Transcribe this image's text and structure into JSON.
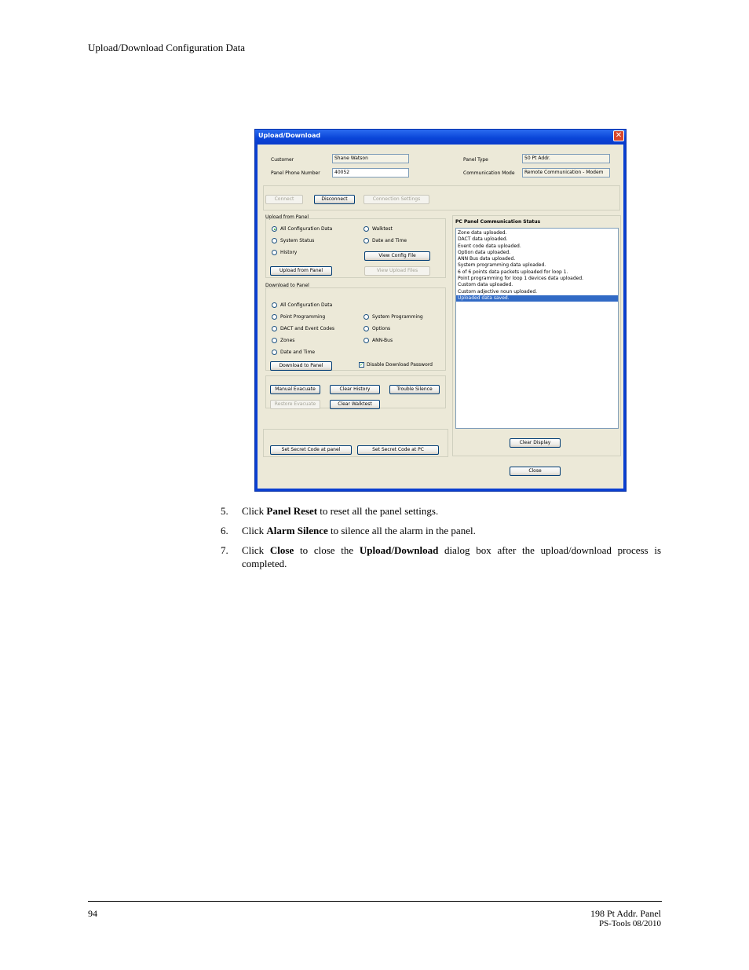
{
  "header": {
    "section_title": "Upload/Download Configuration Data"
  },
  "dialog": {
    "title": "Upload/Download",
    "close_glyph": "✕",
    "customer_label": "Customer",
    "customer_value": "Shane Watson",
    "phone_label": "Panel Phone Number",
    "phone_value": "40052",
    "panel_type_label": "Panel Type",
    "panel_type_value": "50 Pt Addr.",
    "comm_mode_label": "Communication Mode",
    "comm_mode_value": "Remote Communication - Modem",
    "connect_btn": "Connect",
    "disconnect_btn": "Disconnect",
    "conn_settings_btn": "Connection Settings",
    "upload_group_label": "Upload from Panel",
    "upload_options": [
      "All Configuration Data",
      "System Status",
      "History",
      "Walktest",
      "Date and Time"
    ],
    "view_config_btn": "View Config File",
    "upload_from_panel_btn": "Upload from Panel",
    "view_upload_files_btn": "View Upload Files",
    "download_group_label": "Download to Panel",
    "download_options": [
      "All Configuration Data",
      "Point Programming",
      "DACT and Event Codes",
      "Zones",
      "Date and Time",
      "System Programming",
      "Options",
      "ANN-Bus"
    ],
    "download_to_panel_btn": "Download to Panel",
    "disable_pw_label": "Disable Download Password",
    "manual_evac_btn": "Manual Evacuate",
    "clear_history_btn": "Clear History",
    "trouble_silence_btn": "Trouble Silence",
    "restore_evac_btn": "Restore Evacuate",
    "clear_walktest_btn": "Clear Walktest",
    "secret_panel_btn": "Set Secret Code at panel",
    "secret_pc_btn": "Set Secret Code at PC",
    "status_title": "PC Panel Communication Status",
    "status_lines": [
      "Zone data uploaded.",
      "DACT data uploaded.",
      "Event code data uploaded.",
      "Option data uploaded.",
      "ANN Bus data uploaded.",
      "System programming data uploaded.",
      "6 of 6 points data packets uploaded for loop 1.",
      "Point programming for loop 1 devices data uploaded.",
      "Custom data uploaded.",
      "Custom adjective noun uploaded.",
      "Uploaded data saved."
    ],
    "clear_display_btn": "Clear Display",
    "close_btn": "Close"
  },
  "steps": [
    {
      "num": "5.",
      "pre": "Click ",
      "bold": "Panel Reset",
      "post": " to reset all the panel settings."
    },
    {
      "num": "6.",
      "pre": "Click ",
      "bold": "Alarm Silence",
      "post": " to silence all the alarm in the panel."
    },
    {
      "num": "7.",
      "pre": "Click ",
      "bold": "Close",
      "mid": " to close the ",
      "bold2": "Upload/Download",
      "post": " dialog box after the upload/download process is completed."
    }
  ],
  "footer": {
    "page_number": "94",
    "product": "198 Pt Addr. Panel",
    "doc_ref": "PS-Tools  08/2010"
  }
}
